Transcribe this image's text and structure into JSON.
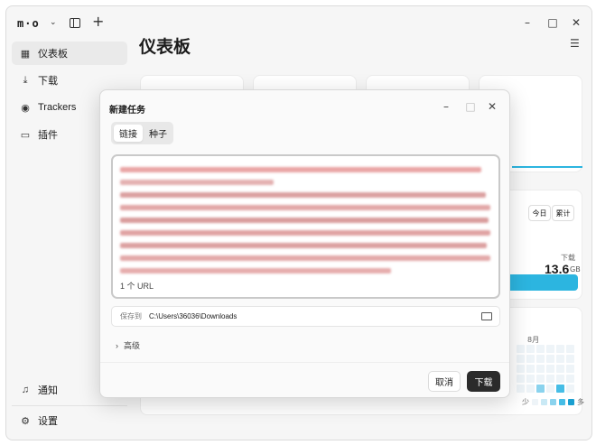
{
  "app": {
    "logo": "m·o",
    "window_controls": [
      "–",
      "□",
      "✕"
    ]
  },
  "sidebar": {
    "items": [
      {
        "label": "仪表板",
        "icon": "grid-icon"
      },
      {
        "label": "下载",
        "icon": "download-icon"
      },
      {
        "label": "Trackers",
        "icon": "radar-icon"
      },
      {
        "label": "插件",
        "icon": "plugin-icon"
      }
    ],
    "bottom": [
      {
        "label": "通知",
        "icon": "bell-icon"
      },
      {
        "label": "设置",
        "icon": "gear-icon"
      }
    ]
  },
  "main": {
    "title": "仪表板",
    "range": {
      "today": "今日",
      "total": "累计"
    },
    "stat": {
      "label": "下载",
      "value": "13.6",
      "unit": "GB"
    },
    "heatmap": {
      "month": "8月",
      "legend_less": "少",
      "legend_more": "多"
    }
  },
  "dialog": {
    "title": "新建任务",
    "tabs": [
      "链接",
      "种子"
    ],
    "url_count": "1 个 URL",
    "save_label": "保存到",
    "save_path": "C:\\Users\\36036\\Downloads",
    "advanced": "高级",
    "cancel": "取消",
    "download": "下载"
  },
  "colors": {
    "accent": "#2cb5e0",
    "primary_button": "#2b2b2b"
  }
}
